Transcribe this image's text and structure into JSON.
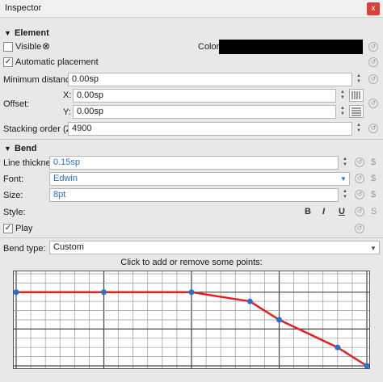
{
  "window": {
    "title": "Inspector",
    "close_label": "x"
  },
  "element_section": {
    "title": "Element",
    "visible_label": "Visible",
    "color_label": "Color:",
    "color_value": "#000000",
    "automatic_placement_label": "Automatic placement",
    "min_distance_label": "Minimum distance:",
    "min_distance_value": "0.00sp",
    "offset_label": "Offset:",
    "offset_x_label": "X:",
    "offset_x_value": "0.00sp",
    "offset_y_label": "Y:",
    "offset_y_value": "0.00sp",
    "stacking_label": "Stacking order (Z):",
    "stacking_value": "4900"
  },
  "bend_section": {
    "title": "Bend",
    "line_thickness_label": "Line thickness:",
    "line_thickness_value": "0.15sp",
    "font_label": "Font:",
    "font_value": "Edwin",
    "size_label": "Size:",
    "size_value": "8pt",
    "style_label": "Style:",
    "bold_label": "B",
    "italic_label": "I",
    "underline_label": "U",
    "strike_label": "S",
    "play_label": "Play",
    "bend_type_label": "Bend type:",
    "bend_type_value": "Custom",
    "chart_caption": "Click to add or remove some points:"
  },
  "chart_data": {
    "type": "line",
    "x": [
      0,
      3,
      6,
      8,
      9,
      11,
      12
    ],
    "values": [
      0,
      0,
      0,
      -0.25,
      -0.75,
      -1.5,
      -2.0
    ],
    "xlim": [
      0,
      12
    ],
    "ylim": [
      -2,
      0.5
    ],
    "grid": true,
    "line_color": "#e02020",
    "point_color": "#2a6fc9"
  },
  "icons": {
    "reset": "reset-icon",
    "dollar": "$"
  }
}
